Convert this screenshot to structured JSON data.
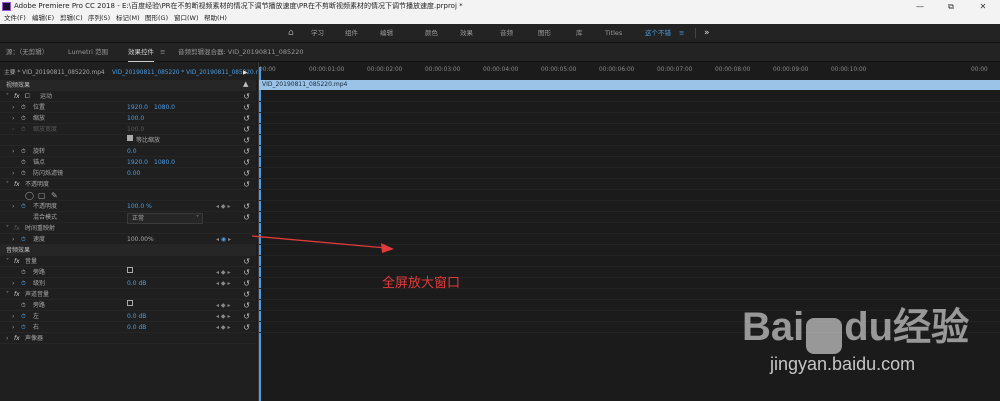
{
  "window": {
    "title": "Adobe Premiere Pro CC 2018 - E:\\百度经验\\PR在不剪断视频素材的情况下调节播放速度\\PR在不剪断视频素材的情况下调节播放速度.prproj *",
    "min_label": "—",
    "max_label": "⧉",
    "close_label": "✕"
  },
  "menu": [
    "文件(F)",
    "编辑(E)",
    "剪辑(C)",
    "序列(S)",
    "标记(M)",
    "图形(G)",
    "窗口(W)",
    "帮助(H)"
  ],
  "workspaces": {
    "home": "⌂",
    "items": [
      "学习",
      "组件",
      "编辑",
      "颜色",
      "效果",
      "音频",
      "图形",
      "库",
      "Titles",
      "这个不错"
    ],
    "active_menu": "≡",
    "more": "»"
  },
  "panels": {
    "source": "源：（无剪辑）",
    "lumetri": "Lumetri 范围",
    "effect_controls": "效果控件",
    "effect_menu": "≡",
    "audio_mixer": "音频剪辑混合器: VID_20190811_085220"
  },
  "effect_controls": {
    "master": "主要 * VID_20190811_085220.mp4",
    "clip": "VID_20190811_085220 * VID_20190811_085220.mp4",
    "video_effects": "视频效果",
    "audio_effects": "音频效果",
    "motion": {
      "label": "运动",
      "position": {
        "label": "位置",
        "x": "1920.0",
        "y": "1080.0"
      },
      "scale": {
        "label": "缩放",
        "value": "100.0"
      },
      "scale_width": {
        "label": "缩放宽度",
        "value": "100.0"
      },
      "uniform_scale": "等比缩放",
      "rotation": {
        "label": "旋转",
        "value": "0.0"
      },
      "anchor": {
        "label": "锚点",
        "x": "1920.0",
        "y": "1080.0"
      },
      "anti_flicker": {
        "label": "防闪烁滤镜",
        "value": "0.00"
      }
    },
    "opacity": {
      "label": "不透明度",
      "value_label": "不透明度",
      "value": "100.0 %",
      "blend_label": "混合模式",
      "blend_value": "正常"
    },
    "time_remap": {
      "label": "时间重映射",
      "speed_label": "速度",
      "speed_value": "100.00%"
    },
    "volume": {
      "label": "音量",
      "bypass": "旁路",
      "level_label": "级别",
      "level_value": "0.0 dB"
    },
    "channel_volume": {
      "label": "声道音量",
      "bypass": "旁路",
      "left_label": "左",
      "left_value": "0.0 dB",
      "right_label": "右",
      "right_value": "0.0 dB"
    },
    "panner": "声像器"
  },
  "timeline": {
    "ticks": [
      "00:00",
      "00:00:01:00",
      "00:00:02:00",
      "00:00:03:00",
      "00:00:04:00",
      "00:00:05:00",
      "00:00:06:00",
      "00:00:07:00",
      "00:00:08:00",
      "00:00:09:00",
      "00:00:10:00",
      "00:00"
    ],
    "clip_name": "VID_20190811_085220.mp4"
  },
  "annotation": "全屏放大窗口",
  "watermark": {
    "bai": "Bai",
    "du": "du",
    "jingyan": "经验",
    "url": "jingyan.baidu.com"
  },
  "colors": {
    "accent": "#4b9ee4",
    "annotation": "#e23a3a",
    "clip": "#9bc2e7"
  }
}
